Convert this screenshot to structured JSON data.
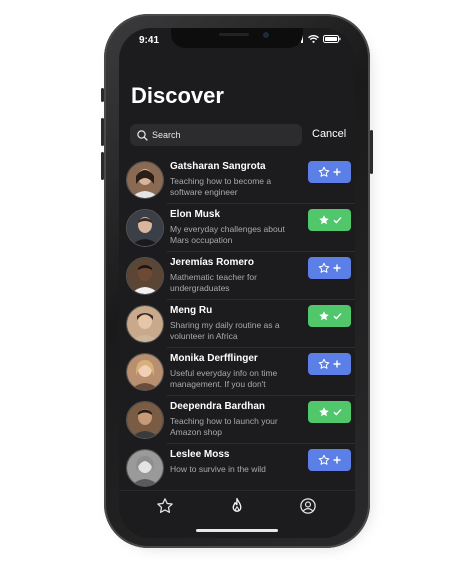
{
  "status": {
    "time": "9:41"
  },
  "header": {
    "title": "Discover"
  },
  "search": {
    "placeholder": "Search",
    "cancel_label": "Cancel"
  },
  "people": [
    {
      "name": "Gatsharan Sangrota",
      "description": "Teaching how to become a software engineer",
      "favorited": false,
      "avatar_color": "#8a6a52"
    },
    {
      "name": "Elon Musk",
      "description": "My everyday challenges about Mars occupation",
      "favorited": true,
      "avatar_color": "#3a3f48"
    },
    {
      "name": "Jeremías Romero",
      "description": "Mathematic teacher for undergraduates",
      "favorited": false,
      "avatar_color": "#5b4636"
    },
    {
      "name": "Meng Ru",
      "description": "Sharing my daily routine as a volunteer in Africa",
      "favorited": true,
      "avatar_color": "#c9a98c"
    },
    {
      "name": "Monika Derfflinger",
      "description": "Useful everyday info on time management. If you don't",
      "favorited": false,
      "avatar_color": "#b89070"
    },
    {
      "name": "Deependra Bardhan",
      "description": "Teaching how to launch your Amazon shop",
      "favorited": true,
      "avatar_color": "#7a5b44"
    },
    {
      "name": "Leslee Moss",
      "description": "How to survive in the wild",
      "favorited": false,
      "avatar_color": "#9a9a9a"
    }
  ],
  "tabs": [
    {
      "icon": "star-icon"
    },
    {
      "icon": "flame-icon"
    },
    {
      "icon": "profile-icon"
    }
  ],
  "colors": {
    "add_button": "#5b7fe6",
    "favorited_button": "#4fc76a",
    "background": "#1c1c1e"
  }
}
